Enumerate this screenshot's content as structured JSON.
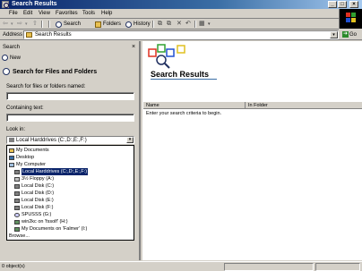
{
  "window": {
    "title": "Search Results"
  },
  "menu": [
    {
      "label": "File"
    },
    {
      "label": "Edit"
    },
    {
      "label": "View"
    },
    {
      "label": "Favorites"
    },
    {
      "label": "Tools"
    },
    {
      "label": "Help"
    }
  ],
  "toolbar": {
    "search_label": "Search",
    "folders_label": "Folders",
    "history_label": "History"
  },
  "address": {
    "label": "Address",
    "value": "Search Results",
    "go_label": "Go"
  },
  "search_pane": {
    "title": "Search",
    "close": "×",
    "new_label": "New",
    "heading": "Search for Files and Folders",
    "name_label": "Search for files or folders named:",
    "name_value": "",
    "containing_label": "Containing text:",
    "containing_value": "",
    "lookin_label": "Look in:",
    "lookin_value": "Local Harddrives (C:,D:,E:,F:)",
    "lookin_options": [
      {
        "label": "My Documents",
        "icon": "folder-icon"
      },
      {
        "label": "Desktop",
        "icon": "desktop-icon"
      },
      {
        "label": "My Computer",
        "icon": "computer-icon"
      },
      {
        "label": "Local Harddrives (C:,D:,E:,F:)",
        "icon": "drive-icon",
        "selected": true
      },
      {
        "label": "3½ Floppy (A:)",
        "icon": "floppy-icon"
      },
      {
        "label": "Local Disk (C:)",
        "icon": "drive-icon"
      },
      {
        "label": "Local Disk (D:)",
        "icon": "drive-icon"
      },
      {
        "label": "Local Disk (E:)",
        "icon": "drive-icon"
      },
      {
        "label": "Local Disk (F:)",
        "icon": "drive-icon"
      },
      {
        "label": "SPUSSS (G:)",
        "icon": "cd-icon"
      },
      {
        "label": "win2kc on 'fssolf' (H:)",
        "icon": "network-drive-icon"
      },
      {
        "label": "My Documents on 'Falmer' (I:)",
        "icon": "network-drive-icon"
      },
      {
        "label": "Browse...",
        "icon": ""
      }
    ]
  },
  "results": {
    "title": "Search Results",
    "columns": [
      {
        "label": "Name"
      },
      {
        "label": "In Folder"
      }
    ],
    "empty_message": "Enter your search criteria to begin."
  },
  "status": {
    "text": "0 object(s)"
  },
  "colors": {
    "titlebar": "#0a246a",
    "selection": "#0a246a",
    "chrome": "#d4d0c8"
  }
}
